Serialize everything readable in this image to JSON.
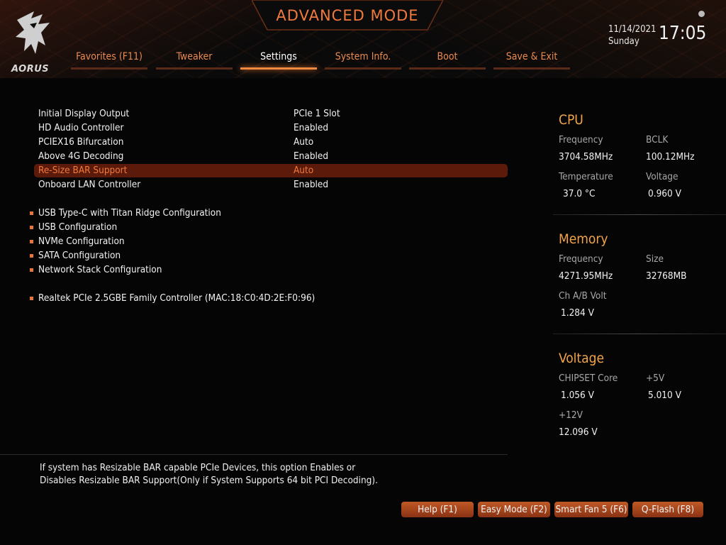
{
  "header": {
    "title": "ADVANCED MODE",
    "logo_text": "AORUS",
    "date": "11/14/2021",
    "day": "Sunday",
    "time": "17:05"
  },
  "tabs": [
    {
      "label": "Favorites (F11)",
      "active": false
    },
    {
      "label": "Tweaker",
      "active": false
    },
    {
      "label": "Settings",
      "active": true
    },
    {
      "label": "System Info.",
      "active": false
    },
    {
      "label": "Boot",
      "active": false
    },
    {
      "label": "Save & Exit",
      "active": false
    }
  ],
  "settings": [
    {
      "label": "Initial Display Output",
      "value": "PCIe 1 Slot"
    },
    {
      "label": "HD Audio Controller",
      "value": "Enabled"
    },
    {
      "label": "PCIEX16 Bifurcation",
      "value": "Auto"
    },
    {
      "label": "Above 4G Decoding",
      "value": "Enabled"
    },
    {
      "label": "Re-Size BAR Support",
      "value": "Auto",
      "selected": true
    },
    {
      "label": "Onboard LAN Controller",
      "value": "Enabled"
    }
  ],
  "submenus": [
    "USB Type-C with Titan Ridge Configuration",
    "USB Configuration",
    "NVMe Configuration",
    "SATA Configuration",
    "Network Stack Configuration"
  ],
  "lan_submenu": "Realtek PCIe 2.5GBE Family Controller (MAC:18:C0:4D:2E:F0:96)",
  "help": {
    "line1": "If system has Resizable BAR capable PCIe Devices, this option Enables or",
    "line2": "Disables Resizable BAR Support(Only if System Supports 64 bit PCI Decoding)."
  },
  "cpu": {
    "title": "CPU",
    "freq_label": "Frequency",
    "freq": "3704.58MHz",
    "bclk_label": "BCLK",
    "bclk": "100.12MHz",
    "temp_label": "Temperature",
    "temp": "37.0 °C",
    "volt_label": "Voltage",
    "volt": "0.960 V"
  },
  "memory": {
    "title": "Memory",
    "freq_label": "Frequency",
    "freq": "4271.95MHz",
    "size_label": "Size",
    "size": "32768MB",
    "volt_label": "Ch A/B Volt",
    "volt": "1.284 V"
  },
  "voltage": {
    "title": "Voltage",
    "chipset_label": "CHIPSET Core",
    "chipset": "1.056 V",
    "p5v_label": "+5V",
    "p5v": "5.010 V",
    "p12v_label": "+12V",
    "p12v": "12.096 V"
  },
  "fkeys": [
    "Help (F1)",
    "Easy Mode (F2)",
    "Smart Fan 5 (F6)",
    "Q-Flash (F8)"
  ],
  "colors": {
    "accent": "#f07a3c",
    "panel_title": "#f3a44a",
    "selected_bg": "#5b1a0a"
  }
}
